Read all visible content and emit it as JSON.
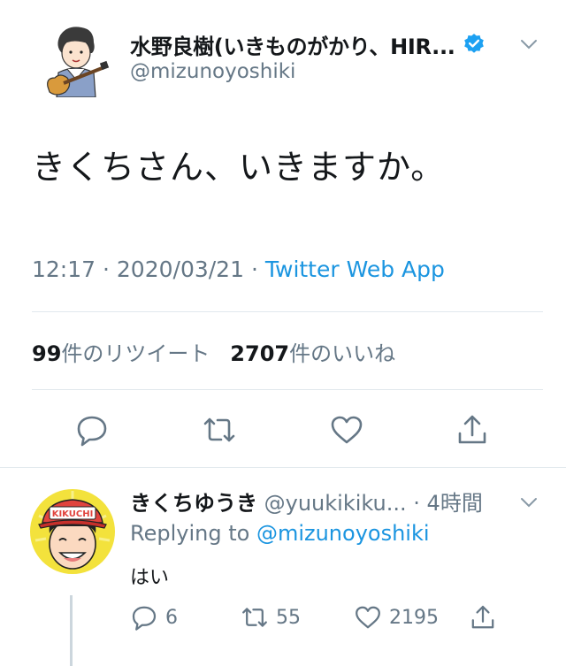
{
  "tweet": {
    "author_name": "水野良樹(いきものがかり、HIR...",
    "author_handle": "@mizunoyoshiki",
    "text": "きくちさん、いきますか。",
    "time": "12:17",
    "date": "2020/03/21",
    "separator": "·",
    "source": "Twitter Web App",
    "retweet_count": "99",
    "retweet_label": "件のリツイート",
    "like_count": "2707",
    "like_label": "件のいいね"
  },
  "reply": {
    "author_name": "きくちゆうき",
    "author_handle": "@yuukikiku...",
    "time_ago": "· 4時間",
    "replying_prefix": "Replying to",
    "replying_to": "@mizunoyoshiki",
    "text": "はい",
    "reply_count": "6",
    "retweet_count": "55",
    "like_count": "2195"
  },
  "icons": {
    "reply": "reply-icon",
    "retweet": "retweet-icon",
    "like": "heart-icon",
    "share": "share-icon",
    "verified": "verified-badge-icon",
    "caret": "chevron-down-icon"
  },
  "colors": {
    "link": "#1b95e0",
    "secondary_text": "#657786",
    "icon": "#657786",
    "divider": "#e1e8ed"
  }
}
